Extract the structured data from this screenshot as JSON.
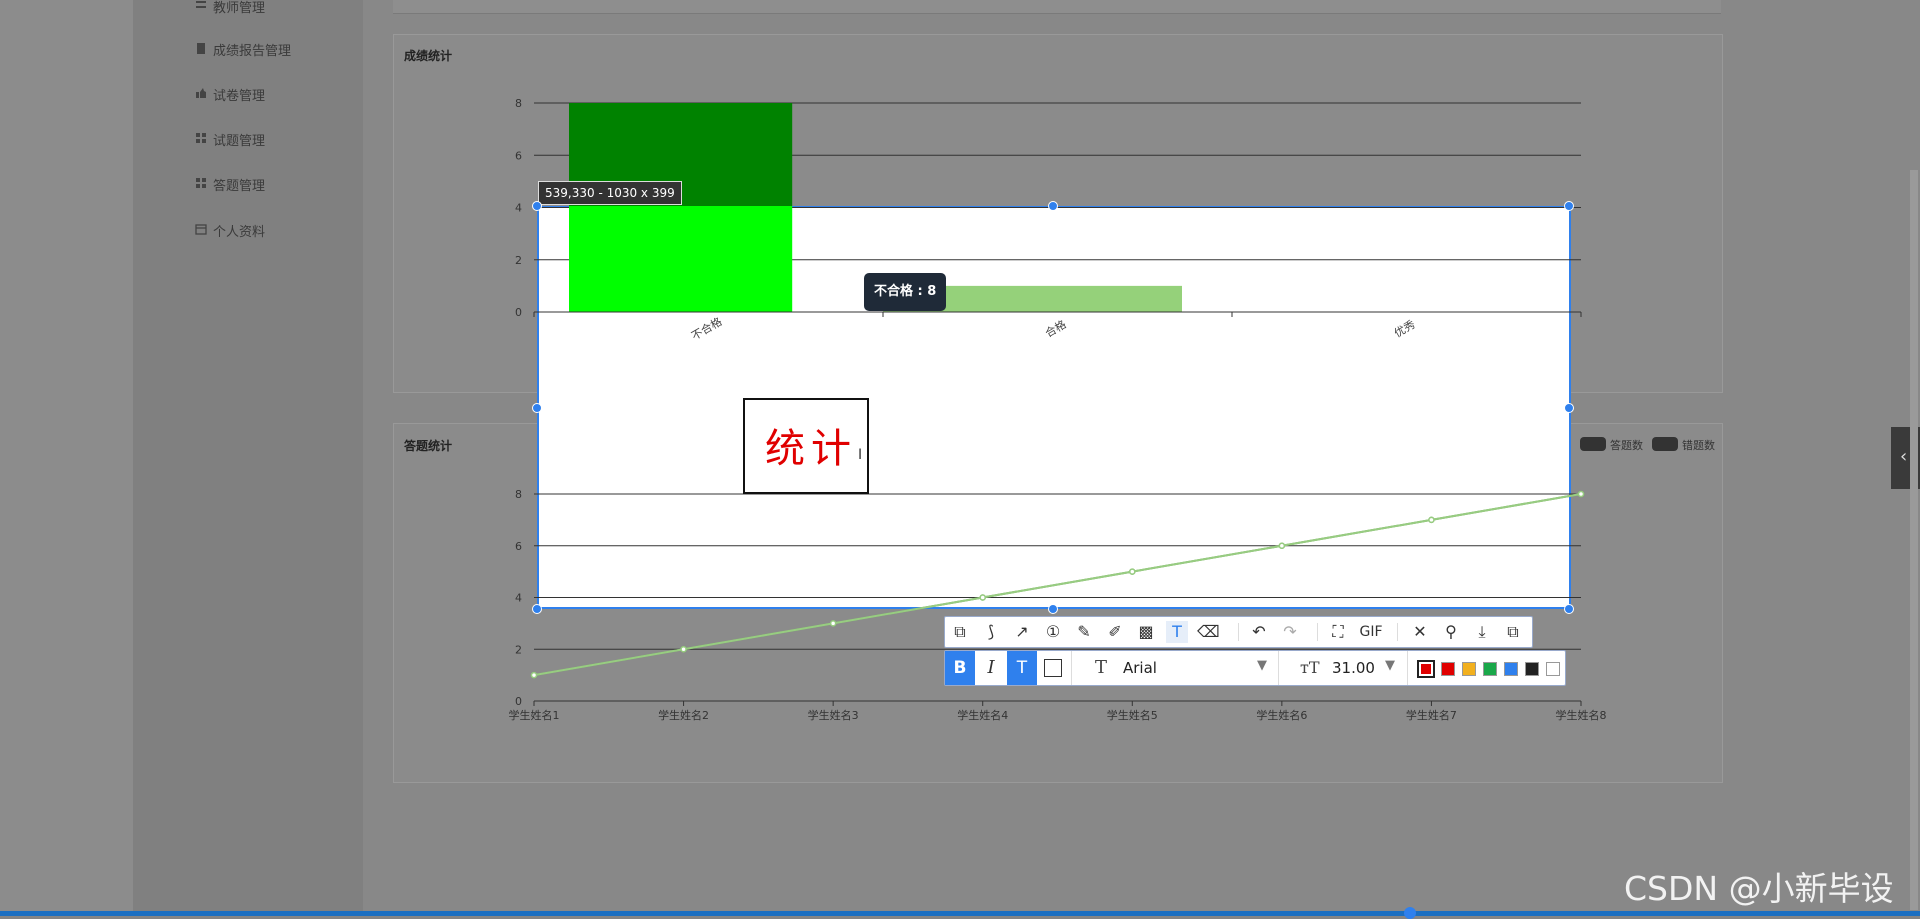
{
  "sidebar": {
    "items": [
      {
        "label": "教师管理",
        "icon": "sliders-icon"
      },
      {
        "label": "成绩报告管理",
        "icon": "clipboard-icon"
      },
      {
        "label": "试卷管理",
        "icon": "thumb-icon"
      },
      {
        "label": "试题管理",
        "icon": "grid-icon"
      },
      {
        "label": "答题管理",
        "icon": "grid-icon"
      },
      {
        "label": "个人资料",
        "icon": "calendar-icon"
      }
    ]
  },
  "card1": {
    "title": "成绩统计"
  },
  "card2": {
    "title": "答题统计",
    "legend": [
      "答题数",
      "错题数"
    ]
  },
  "screenshot_tool": {
    "size_label": "539,330 - 1030 x 399",
    "tooltip": "不合格 : 8",
    "text_box": "统计",
    "font_name": "Arial",
    "font_size": "31.00",
    "gif_label": "GIF",
    "colors": [
      "#e00000",
      "#e00000",
      "#f2b01e",
      "#1aa84a",
      "#2f80ed",
      "#222222",
      "#ffffff"
    ]
  },
  "watermark": "CSDN @小新毕设",
  "chart_data": [
    {
      "type": "bar",
      "categories": [
        "不合格",
        "合格",
        "优秀"
      ],
      "values": [
        8,
        1,
        0
      ],
      "ylim": [
        0,
        8
      ],
      "yticks": [
        "0",
        "2",
        "4",
        "6",
        "8"
      ]
    },
    {
      "type": "line",
      "categories": [
        "学生姓名1",
        "学生姓名2",
        "学生姓名3",
        "学生姓名4",
        "学生姓名5",
        "学生姓名6",
        "学生姓名7",
        "学生姓名8"
      ],
      "series": [
        {
          "name": "答题数",
          "values": [
            1,
            2,
            3,
            4,
            5,
            6,
            7,
            8
          ]
        },
        {
          "name": "错题数",
          "values": [
            1,
            2,
            3,
            4,
            5,
            6,
            7,
            8
          ]
        }
      ],
      "ylim": [
        0,
        8
      ],
      "yticks": [
        "0",
        "2",
        "4",
        "6",
        "8"
      ]
    }
  ]
}
